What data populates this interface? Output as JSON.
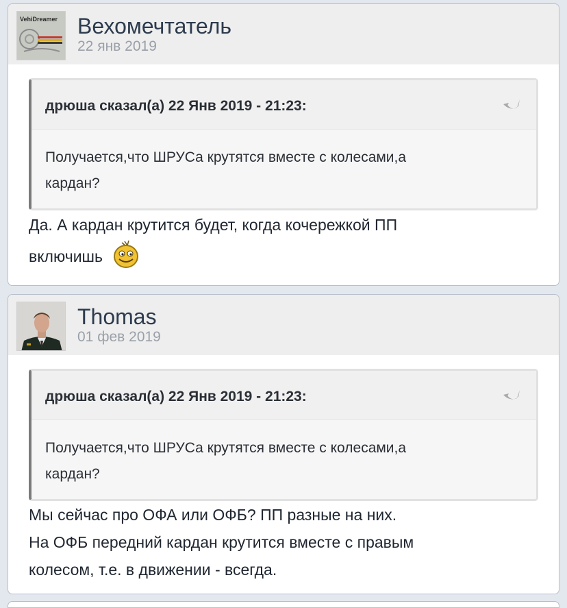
{
  "posts": [
    {
      "author": "Вехомечтатель",
      "date": "22 янв 2019",
      "avatar_text": "VehiDreamer",
      "quote": {
        "title": "дрюша сказал(а) 22 Янв 2019 - 21:23:",
        "text_line1": "Получается,что ШРУСа крутятся вместе с колесами,а",
        "text_line2": "кардан?"
      },
      "body_line1": "Да. А кардан крутится будет, когда кочережкой ПП",
      "body_line2": "включишь"
    },
    {
      "author": "Thomas",
      "date": "01 фев 2019",
      "quote": {
        "title": "дрюша сказал(а) 22 Янв 2019 - 21:23:",
        "text_line1": "Получается,что ШРУСа крутятся вместе с колесами,а",
        "text_line2": "кардан?"
      },
      "body_line1": "Мы сейчас про ОФА или ОФБ? ПП разные на них.",
      "body_line2": "На ОФБ передний кардан крутится вместе с правым",
      "body_line3": "колесом, т.е. в движении - всегда."
    }
  ],
  "colors": {
    "page_bg": "#e3e8ef",
    "header_bg": "#eeeeee",
    "author": "#2d3b4e",
    "date": "#9aa0a8",
    "quote_border": "#7b7b7b"
  },
  "icons": [
    "return-arrow-icon",
    "smiley-icon"
  ]
}
